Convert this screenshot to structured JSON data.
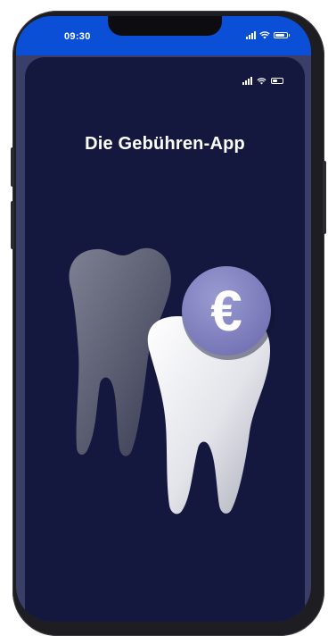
{
  "status_bar": {
    "time": "09:30",
    "icons": [
      "signal-icon",
      "wifi-icon",
      "battery-icon"
    ]
  },
  "app": {
    "title": "Die Gebühren-App",
    "inner_status_icons": [
      "signal-icon",
      "wifi-icon",
      "battery-icon"
    ],
    "illustration": {
      "icons": [
        "tooth-dark-icon",
        "tooth-white-icon",
        "euro-coin-icon"
      ],
      "coin_symbol": "€"
    }
  },
  "colors": {
    "status_bar": "#0b4fd6",
    "background": "#14183f",
    "coin": "#7f7fc0",
    "title": "#ffffff"
  }
}
